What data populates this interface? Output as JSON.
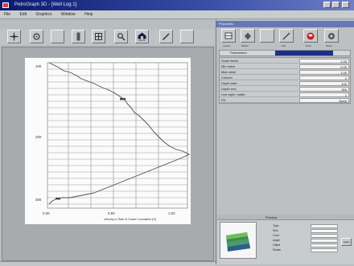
{
  "window": {
    "title": "PetroGraph 3D - [Well Log 1]"
  },
  "menu": [
    "File",
    "Edit",
    "Graphics",
    "Window",
    "Help"
  ],
  "toolbar": {
    "buttons": [
      {
        "name": "move-icon"
      },
      {
        "name": "rotate-icon"
      },
      {
        "name": "blank"
      },
      {
        "name": "ruler-icon"
      },
      {
        "name": "grid-icon"
      },
      {
        "name": "zoom-icon"
      },
      {
        "name": "house-icon"
      },
      {
        "name": "pen-icon"
      },
      {
        "name": "blank"
      }
    ],
    "house_label": "Home"
  },
  "plot": {
    "y_ticks": [
      "100",
      "200",
      "300"
    ],
    "x_ticks": [
      "0.00",
      "0.50",
      "1.00"
    ],
    "xlabel": "Velocity or Rate of Grade Cumulative (H)"
  },
  "right_panel": {
    "title": "Properties",
    "tools": [
      {
        "name": "layers-icon",
        "label": "Layers"
      },
      {
        "name": "marker-icon",
        "label": "Marker"
      },
      {
        "name": "blank",
        "label": ""
      },
      {
        "name": "edit-icon",
        "label": "Edit"
      },
      {
        "name": "rock-icon",
        "label": "Rock"
      },
      {
        "name": "gear-icon",
        "label": "Setup"
      }
    ],
    "tab": "Parameters",
    "rows": [
      {
        "label": "Scale factor",
        "value": "1.00"
      },
      {
        "label": "Min value",
        "value": "0.00"
      },
      {
        "label": "Max value",
        "value": "1.00"
      },
      {
        "label": "Column",
        "value": "2"
      },
      {
        "label": "Depth start",
        "value": "100"
      },
      {
        "label": "Depth end",
        "value": "300"
      },
      {
        "label": "Line style / width",
        "value": "1"
      },
      {
        "label": "Fill",
        "value": "None"
      }
    ],
    "bottom": {
      "header": "Preview",
      "rows": [
        {
          "label": "Type"
        },
        {
          "label": "Size"
        },
        {
          "label": "Color"
        },
        {
          "label": "Angle"
        },
        {
          "label": "Offset"
        },
        {
          "label": "Shade"
        }
      ],
      "button": "Apply"
    }
  },
  "colors": {
    "accent": "#0a1a6e",
    "tab_active": "#1c2f86",
    "trace": "#4a4a4a",
    "grid": "#8c8f91"
  }
}
